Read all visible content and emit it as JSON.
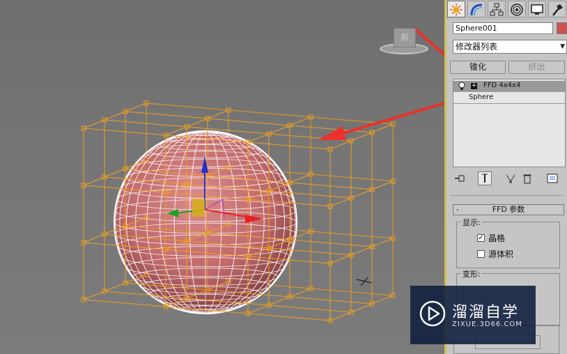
{
  "viewport": {
    "viewcube_label": "前",
    "colors": {
      "lattice": "#f0a020",
      "sphere": "#c0696a",
      "wire": "#ffffff",
      "arrow": "#e8322a",
      "gizmo_x": "#e82020",
      "gizmo_y": "#20a020",
      "gizmo_z": "#2030d0"
    }
  },
  "command_panel": {
    "tabs": [
      {
        "name": "create-tab",
        "icon": "sun-star-icon"
      },
      {
        "name": "modify-tab",
        "icon": "bend-curve-icon"
      },
      {
        "name": "hierarchy-tab",
        "icon": "hierarchy-icon"
      },
      {
        "name": "motion-tab",
        "icon": "motion-circle-icon"
      },
      {
        "name": "display-tab",
        "icon": "monitor-icon"
      },
      {
        "name": "utilities-tab",
        "icon": "hammer-icon"
      }
    ],
    "object_name": "Sphere001",
    "object_color": "#d0504e",
    "modifier_list": "修改器列表",
    "buttons": {
      "lathe": "锥化",
      "extrude": "挤出"
    },
    "stack": {
      "ffd": "FFD 4x4x4",
      "expand_symbol": "+",
      "sphere": "Sphere"
    },
    "rollout": {
      "collapse_symbol": "-",
      "title": "FFD 参数"
    },
    "display_group": {
      "title": "显示:",
      "lattice_label": "晶格",
      "lattice_checked": "✓",
      "source_volume_label": "源体积"
    },
    "deform_group": {
      "title": "变形:"
    }
  },
  "watermark": {
    "title": "溜溜自学",
    "url": "ZIXUE.3D66.COM"
  }
}
